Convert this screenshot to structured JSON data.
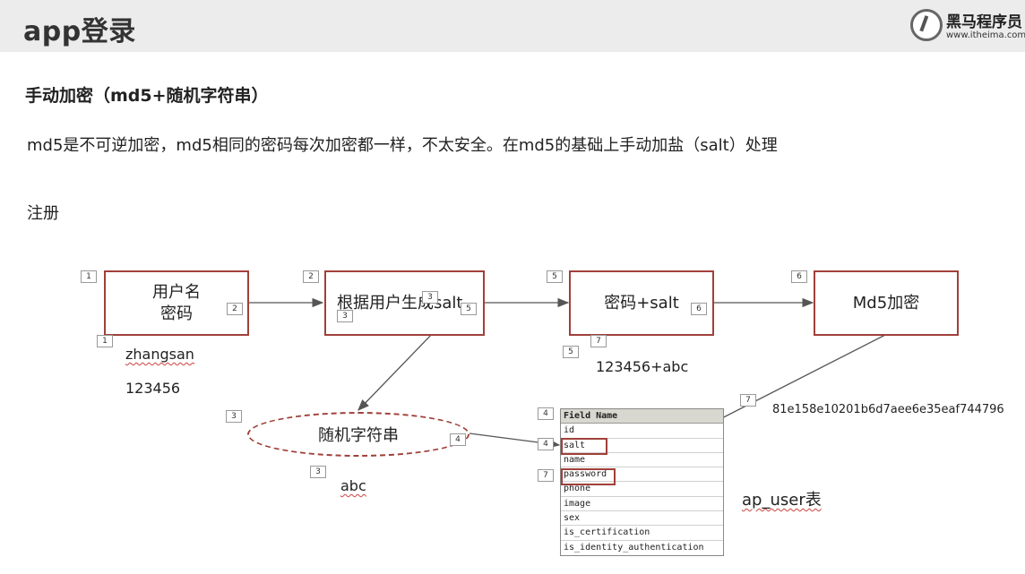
{
  "header": {
    "title": "app登录",
    "logo_name": "黑马程序员",
    "logo_url": "www.itheima.com"
  },
  "subtitle": "手动加密（md5+随机字符串）",
  "description": "md5是不可逆加密，md5相同的密码每次加密都一样，不太安全。在md5的基础上手动加盐（salt）处理",
  "section": "注册",
  "boxes": {
    "username_line1": "用户名",
    "username_line2": "密码",
    "generate_salt": "根据用户生成salt",
    "password_salt": "密码+salt",
    "md5": "Md5加密",
    "random_string": "随机字符串"
  },
  "values": {
    "username": "zhangsan",
    "password": "123456",
    "salt": "abc",
    "combined": "123456+abc",
    "hash": "81e158e10201b6d7aee6e35eaf744796"
  },
  "steps": [
    "1",
    "2",
    "2",
    "3",
    "3",
    "5",
    "5",
    "6",
    "6",
    "1",
    "7",
    "5",
    "3",
    "4",
    "4",
    "7",
    "3",
    "4",
    "7"
  ],
  "table": {
    "header": "Field Name",
    "fields": [
      "id",
      "salt",
      "name",
      "password",
      "phone",
      "image",
      "sex",
      "is_certification",
      "is_identity_authentication"
    ],
    "name": "ap_user表"
  },
  "colors": {
    "accent": "#a0403a",
    "header_bg": "#ececec"
  }
}
